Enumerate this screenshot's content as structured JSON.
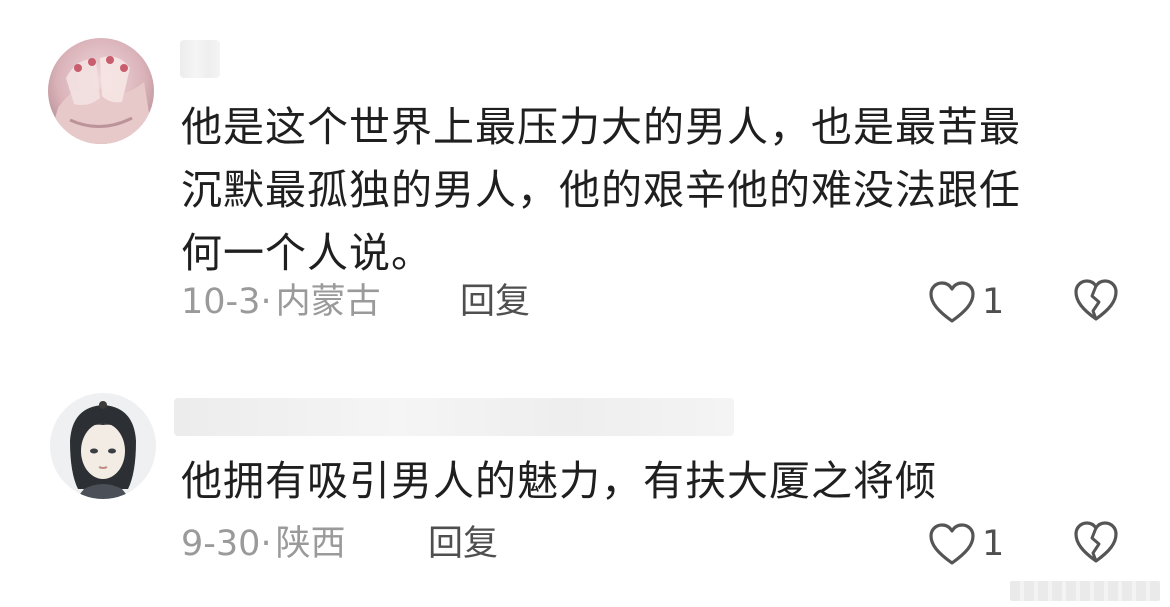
{
  "comments": [
    {
      "text_lines": [
        "他是这个世界上最压力大的男人，也是最苦最",
        "沉默最孤独的男人，他的艰辛他的难没法跟任",
        "何一个人说。"
      ],
      "date": "10-3",
      "separator": "·",
      "location": "内蒙古",
      "reply_label": "回复",
      "like_count": "1",
      "like_icon": "heart-outline-icon",
      "dislike_icon": "broken-heart-icon"
    },
    {
      "text_lines": [
        "他拥有吸引男人的魅力，有扶大厦之将倾"
      ],
      "date": "9-30",
      "separator": "·",
      "location": "陕西",
      "reply_label": "回复",
      "like_count": "1",
      "like_icon": "heart-outline-icon",
      "dislike_icon": "broken-heart-icon"
    }
  ],
  "colors": {
    "text": "#1f1f1f",
    "meta": "#9a9a9a",
    "reply": "#4f4f4f",
    "icon": "#555555"
  }
}
